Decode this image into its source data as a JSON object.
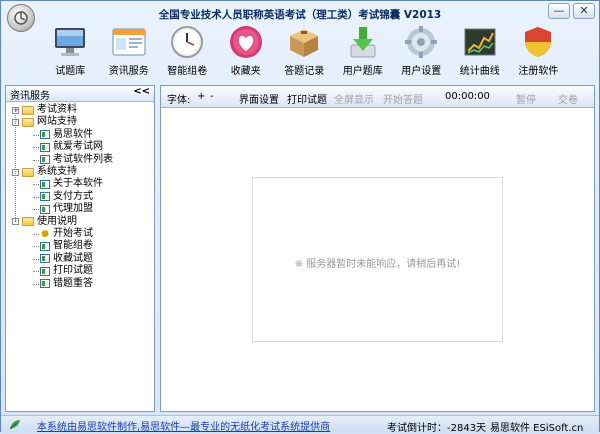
{
  "window": {
    "title": "全国专业技术人员职称英语考试（理工类）考试锦囊 V2013",
    "minimize": "—",
    "close": "✕"
  },
  "toolbar": [
    {
      "label": "试题库",
      "icon": "monitor-icon"
    },
    {
      "label": "资讯服务",
      "icon": "browser-window-icon"
    },
    {
      "label": "智能组卷",
      "icon": "clock-icon"
    },
    {
      "label": "收藏夹",
      "icon": "heart-icon"
    },
    {
      "label": "答题记录",
      "icon": "box-icon"
    },
    {
      "label": "用户题库",
      "icon": "download-arrow-icon"
    },
    {
      "label": "用户设置",
      "icon": "gear-icon"
    },
    {
      "label": "统计曲线",
      "icon": "line-chart-icon"
    },
    {
      "label": "注册软件",
      "icon": "shield-icon"
    }
  ],
  "left_panel": {
    "title": "资讯服务",
    "collapse": "<<",
    "tree": [
      {
        "label": "考试资料",
        "level": 0,
        "type": "folder",
        "toggle": "+"
      },
      {
        "label": "网站支持",
        "level": 0,
        "type": "folder",
        "toggle": "-"
      },
      {
        "label": "易思软件",
        "level": 1,
        "type": "doc"
      },
      {
        "label": "就爱考试网",
        "level": 1,
        "type": "doc"
      },
      {
        "label": "考试软件列表",
        "level": 1,
        "type": "doc"
      },
      {
        "label": "系统支持",
        "level": 0,
        "type": "folder",
        "toggle": "-"
      },
      {
        "label": "关于本软件",
        "level": 1,
        "type": "doc"
      },
      {
        "label": "支付方式",
        "level": 1,
        "type": "doc"
      },
      {
        "label": "代理加盟",
        "level": 1,
        "type": "doc"
      },
      {
        "label": "使用说明",
        "level": 0,
        "type": "folder",
        "toggle": "-"
      },
      {
        "label": "开始考试",
        "level": 1,
        "type": "bulb"
      },
      {
        "label": "智能组卷",
        "level": 1,
        "type": "doc"
      },
      {
        "label": "收藏试题",
        "level": 1,
        "type": "doc"
      },
      {
        "label": "打印试题",
        "level": 1,
        "type": "doc"
      },
      {
        "label": "错题重答",
        "level": 1,
        "type": "doc"
      }
    ]
  },
  "right_toolbar": {
    "font_label": "字体:",
    "font_plus": "+",
    "font_minus": "-",
    "page_setup": "界面设置",
    "print": "打印试题",
    "fullscreen": "全屏显示",
    "start": "开始答题",
    "timer": "00:00:00",
    "pause": "暂停",
    "submit": "交卷"
  },
  "content": {
    "message": "※ 服务器暂时未能响应，请稍后再试!"
  },
  "statusbar": {
    "slogan": "本系统由易思软件制作,易思软件—最专业的无纸化考试系统提供商",
    "countdown": "考试倒计时：-2843天",
    "brand": "易思软件 ESiSoft.cn"
  },
  "colors": {
    "window_bg": "#d7e6f8",
    "link": "#1a3fb0",
    "title": "#0b2c64"
  }
}
